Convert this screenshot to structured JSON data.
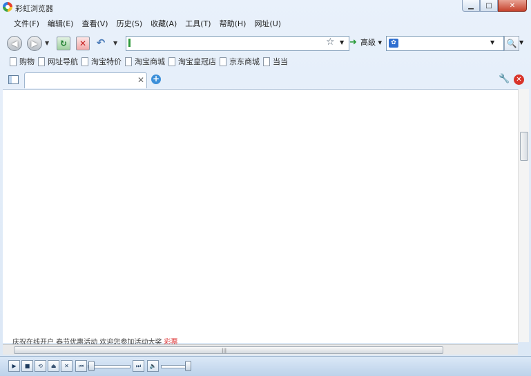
{
  "window": {
    "title": "彩虹浏览器"
  },
  "menu": [
    "文件(F)",
    "编辑(E)",
    "查看(V)",
    "历史(S)",
    "收藏(A)",
    "工具(T)",
    "帮助(H)",
    "网址(U)"
  ],
  "toolbar": {
    "advanced_label": "高级"
  },
  "address": {
    "value": ""
  },
  "search": {
    "value": ""
  },
  "bookmarks": [
    "购物",
    "网址导航",
    "淘宝特价",
    "淘宝商城",
    "淘宝皇冠店",
    "京东商城",
    "当当"
  ],
  "tab": {
    "title": ""
  },
  "content": {
    "ticker_text": "庆祝在线开户 春节优惠活动 欢迎您参加活动大奖",
    "ticker_highlight": "彩票"
  },
  "colors": {
    "accent": "#3b8fd9",
    "go": "#2b9b3a",
    "close": "#d9342a"
  },
  "icons": {
    "back": "back-icon",
    "forward": "forward-icon",
    "refresh": "refresh-icon",
    "stop": "stop-icon",
    "undo": "undo-icon",
    "star": "star-icon",
    "search": "search-icon",
    "wrench": "wrench-icon"
  }
}
